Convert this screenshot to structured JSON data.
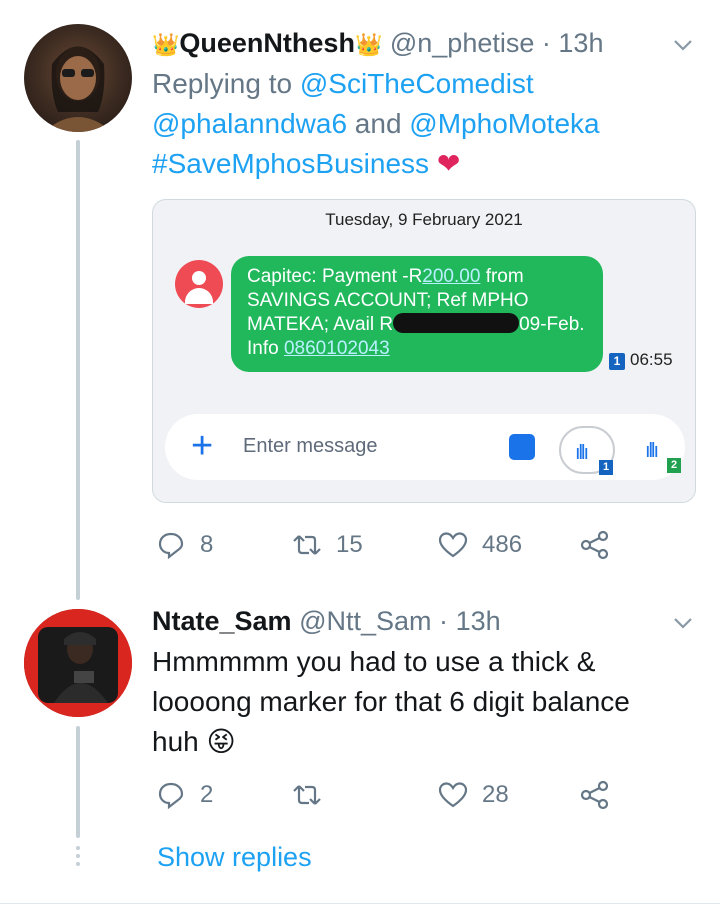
{
  "tweet1": {
    "crown": "👑",
    "display_name": "QueenNthesh",
    "handle": "@n_phetise",
    "separator": "·",
    "time": "13h",
    "replying_prefix": "Replying to",
    "reply_to_1": "@SciTheComedist",
    "reply_to_2": "@phalanndwa6",
    "and_word": "and",
    "reply_to_3": "@MphoMoteka",
    "hashtag": "#SaveMphosBusiness",
    "emoji": "❤",
    "media": {
      "date": "Tuesday, 9 February 2021",
      "msg_line1_a": "Capitec: Payment -R",
      "msg_amount": "200.00",
      "msg_line1_b": " from",
      "msg_line2": "SAVINGS ACCOUNT; Ref MPHO",
      "msg_line3_a": "MATEKA; Avail R",
      "msg_line3_b": "09-Feb.",
      "msg_line4_a": "Info ",
      "msg_phone": "0860102043",
      "sim": "1",
      "time": "06:55",
      "input_placeholder": "Enter message",
      "sim_badge_1": "1",
      "sim_badge_2": "2"
    },
    "actions": {
      "replies": "8",
      "retweets": "15",
      "likes": "486"
    }
  },
  "tweet2": {
    "display_name": "Ntate_Sam",
    "handle": "@Ntt_Sam",
    "separator": "·",
    "time": "13h",
    "text_line1": "Hmmmmm you had to use a thick &",
    "text_line2": "loooong marker for that 6 digit balance",
    "text_line3": "huh",
    "emoji": "😝",
    "actions": {
      "replies": "2",
      "retweets": "",
      "likes": "28"
    }
  },
  "show_replies": "Show replies",
  "colors": {
    "accent": "#1da1f2",
    "muted": "#657786",
    "sms_bubble": "#21b85c"
  }
}
